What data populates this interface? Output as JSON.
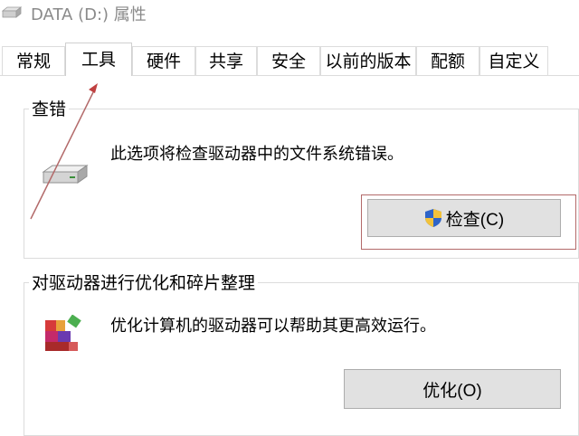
{
  "window": {
    "title": "DATA (D:) 属性"
  },
  "tabs": [
    {
      "label": "常规"
    },
    {
      "label": "工具",
      "active": true
    },
    {
      "label": "硬件"
    },
    {
      "label": "共享"
    },
    {
      "label": "安全"
    },
    {
      "label": "以前的版本"
    },
    {
      "label": "配额"
    },
    {
      "label": "自定义"
    }
  ],
  "error_checking": {
    "title": "查错",
    "description": "此选项将检查驱动器中的文件系统错误。",
    "button_label": "检查(C)",
    "icon": "drive-icon",
    "button_icon": "uac-shield-icon"
  },
  "optimize": {
    "title": "对驱动器进行优化和碎片整理",
    "description": "优化计算机的驱动器可以帮助其更高效运行。",
    "button_label": "优化(O)",
    "icon": "defrag-icon"
  },
  "annotation": {
    "highlight_color": "#b36a6a"
  }
}
